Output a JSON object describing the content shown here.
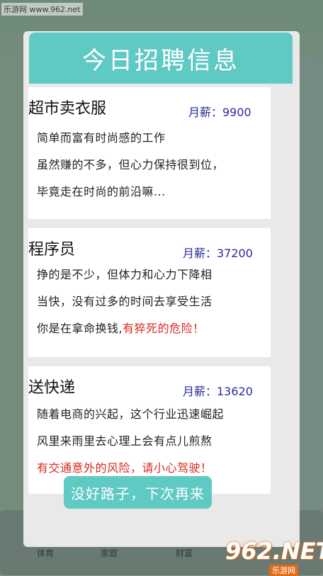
{
  "watermark": {
    "top": "乐游网 www.962.net",
    "logo": "962.NET",
    "sub": "乐游网"
  },
  "dialog": {
    "title": "今日招聘信息"
  },
  "jobs": [
    {
      "title": "超市卖衣服",
      "salary": "月薪：9900",
      "lines": [
        "简单而富有时尚感的工作",
        "虽然赚的不多，但心力保持很到位，",
        "毕竟走在时尚的前沿嘛..."
      ],
      "warning": ""
    },
    {
      "title": "程序员",
      "salary": "月薪：37200",
      "lines": [
        "挣的是不少，但体力和心力下降相",
        "当快，没有过多的时间去享受生活",
        "你是在拿命换钱,"
      ],
      "warning": "有猝死的危险！"
    },
    {
      "title": "送快递",
      "salary": "月薪：13620",
      "lines": [
        "随着电商的兴起，这个行业迅速崛起",
        "风里来雨里去心理上会有点儿煎熬"
      ],
      "warning": "有交通意外的风险，请小心驾驶！"
    }
  ],
  "footer": {
    "button_label": "没好路子，下次再来"
  },
  "background_labels": {
    "tab1": "体育",
    "tab2": "家庭",
    "tab3": "财富"
  }
}
